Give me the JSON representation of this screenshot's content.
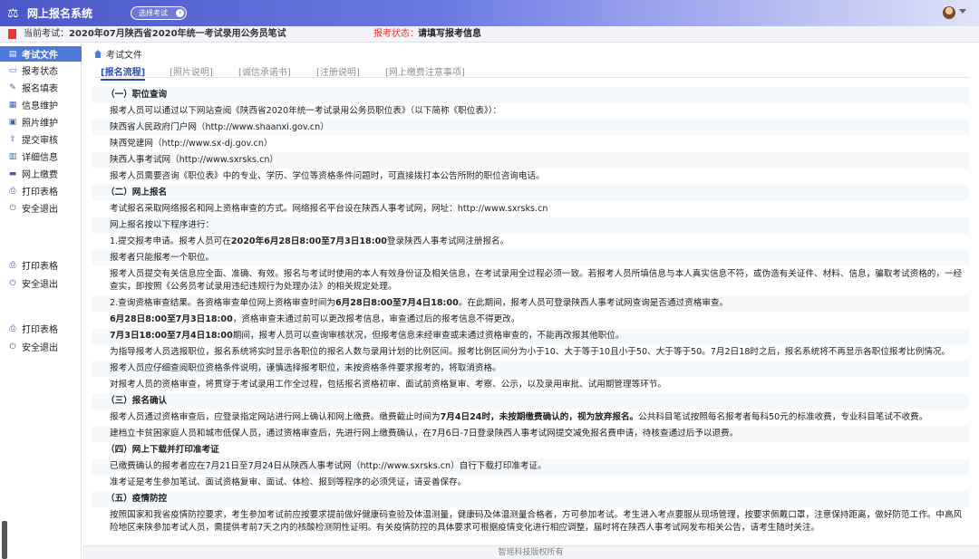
{
  "header": {
    "app_title": "网上报名系统",
    "select_exam_label": "选择考试",
    "avatar": "user-avatar"
  },
  "infobar": {
    "current_exam_label": "当前考试：",
    "current_exam_value": "2020年07月陕西省2020年统一考试录用公务员笔试",
    "status_label": "报考状态：",
    "status_value": "请填写报考信息"
  },
  "sidebar": {
    "items": [
      {
        "label": "考试文件",
        "icon": "document-icon"
      },
      {
        "label": "报考状态",
        "icon": "monitor-icon"
      },
      {
        "label": "报名填表",
        "icon": "pencil-icon"
      },
      {
        "label": "信息维护",
        "icon": "edit-icon"
      },
      {
        "label": "照片维护",
        "icon": "photo-icon"
      },
      {
        "label": "提交审核",
        "icon": "upload-icon"
      },
      {
        "label": "详细信息",
        "icon": "info-icon"
      },
      {
        "label": "网上缴费",
        "icon": "card-icon"
      },
      {
        "label": "打印表格",
        "icon": "printer-icon"
      },
      {
        "label": "安全退出",
        "icon": "power-icon"
      },
      {
        "label": "打印表格",
        "icon": "printer-icon"
      },
      {
        "label": "安全退出",
        "icon": "power-icon"
      },
      {
        "label": "打印表格",
        "icon": "printer-icon"
      },
      {
        "label": "安全退出",
        "icon": "power-icon"
      }
    ]
  },
  "main": {
    "breadcrumb": "考试文件",
    "tabs": [
      "[报名流程]",
      "[照片说明]",
      "[诚信承诺书]",
      "[注册说明]",
      "[网上缴费注意事项]"
    ],
    "lines": [
      {
        "t": "（一）职位查询"
      },
      {
        "t": "报考人员可以通过以下网站查阅《陕西省2020年统一考试录用公务员职位表》（以下简称《职位表》）："
      },
      {
        "t": "陕西省人民政府门户网（http://www.shaanxi.gov.cn）"
      },
      {
        "t": "陕西党建网（http://www.sx-dj.gov.cn）"
      },
      {
        "t": "陕西人事考试网（http://www.sxrsks.cn）"
      },
      {
        "t": "报考人员需要咨询《职位表》中的专业、学历、学位等资格条件问题时，可直接拨打本公告所附的职位咨询电话。"
      },
      {
        "t": "（二）网上报名"
      },
      {
        "t": "考试报名采取网络报名和网上资格审查的方式。网络报名平台设在陕西人事考试网，网址：http://www.sxrsks.cn"
      },
      {
        "t": "网上报名按以下程序进行："
      },
      {
        "a": "1.提交报考申请。报考人员可在",
        "b": "2020年6月28日8:00至7月3日18:00",
        "c": "登录陕西人事考试网注册报名。"
      },
      {
        "t": "报考者只能报考一个职位。"
      },
      {
        "t": "报考人员提交有关信息应全面、准确、有效。报名与考试时使用的本人有效身份证及相关信息，在考试录用全过程必须一致。若报考人员所填信息与本人真实信息不符，或伪造有关证件、材料、信息，骗取考试资格的，一经查实，即按照《公务员考试录用违纪违规行为处理办法》的相关规定处理。"
      },
      {
        "a": "2.查询资格审查结果。各资格审查单位网上资格审查时间为",
        "b": "6月28日8:00至7月4日18:00",
        "c": "。在此期间，报考人员可登录陕西人事考试网查询是否通过资格审查。"
      },
      {
        "a": "",
        "b": "6月28日8:00至7月3日18:00",
        "c": "，资格审查未通过前可以更改报考信息，审查通过后的报考信息不得更改。"
      },
      {
        "a": "",
        "b": "7月3日18:00至7月4日18:00",
        "c": "期间，报考人员可以查询审核状况，但报考信息未经审查或未通过资格审查的，不能再改报其他职位。"
      },
      {
        "t": "为指导报考人员选报职位，报名系统将实时显示各职位的报名人数与录用计划的比例区间。报考比例区间分为小于10、大于等于10且小于50、大于等于50。7月2日18时之后，报名系统将不再显示各职位报考比例情况。"
      },
      {
        "t": "报考人员应仔细查阅职位资格条件说明，谨慎选择报考职位，未按资格条件要求报考的，将取消资格。"
      },
      {
        "t": "对报考人员的资格审查，将贯穿于考试录用工作全过程，包括报名资格初审、面试前资格复审、考察、公示，以及录用审批、试用期管理等环节。"
      },
      {
        "t": "（三）报名确认"
      },
      {
        "a": "报考人员通过资格审查后，应登录指定网站进行网上确认和网上缴费。缴费截止时间为",
        "b": "7月4日24时，未按期缴费确认的，视为放弃报名。",
        "c": "公共科目笔试按照每名报考者每科50元的标准收费，专业科目笔试不收费。"
      },
      {
        "t": "建档立卡贫困家庭人员和城市低保人员，通过资格审查后，先进行网上缴费确认，在7月6日-7日登录陕西人事考试网提交减免报名费申请，待核查通过后予以退费。"
      },
      {
        "t": "（四）网上下载并打印准考证"
      },
      {
        "t": "已缴费确认的报考者应在7月21日至7月24日从陕西人事考试网（http://www.sxrsks.cn）自行下载打印准考证。"
      },
      {
        "t": "准考证是考生参加笔试、面试资格复审、面试、体检、报到等程序的必须凭证，请妥善保存。"
      },
      {
        "t": "（五）疫情防控"
      },
      {
        "t": "按照国家和我省疫情防控要求，考生参加考试前应按要求提前做好健康码查验及体温测量，健康码及体温测量合格者，方可参加考试。考生进入考点要服从现场管理，按要求佩戴口罩，注意保持距离，做好防范工作。中高风险地区来陕参加考试人员，需提供考前7天之内的核酸检测阴性证明。有关疫情防控的具体要求可根据疫情变化进行相应调整，届时将在陕西人事考试网发布相关公告，请考生随时关注。"
      }
    ],
    "footer": "智瑶科技版权所有"
  }
}
